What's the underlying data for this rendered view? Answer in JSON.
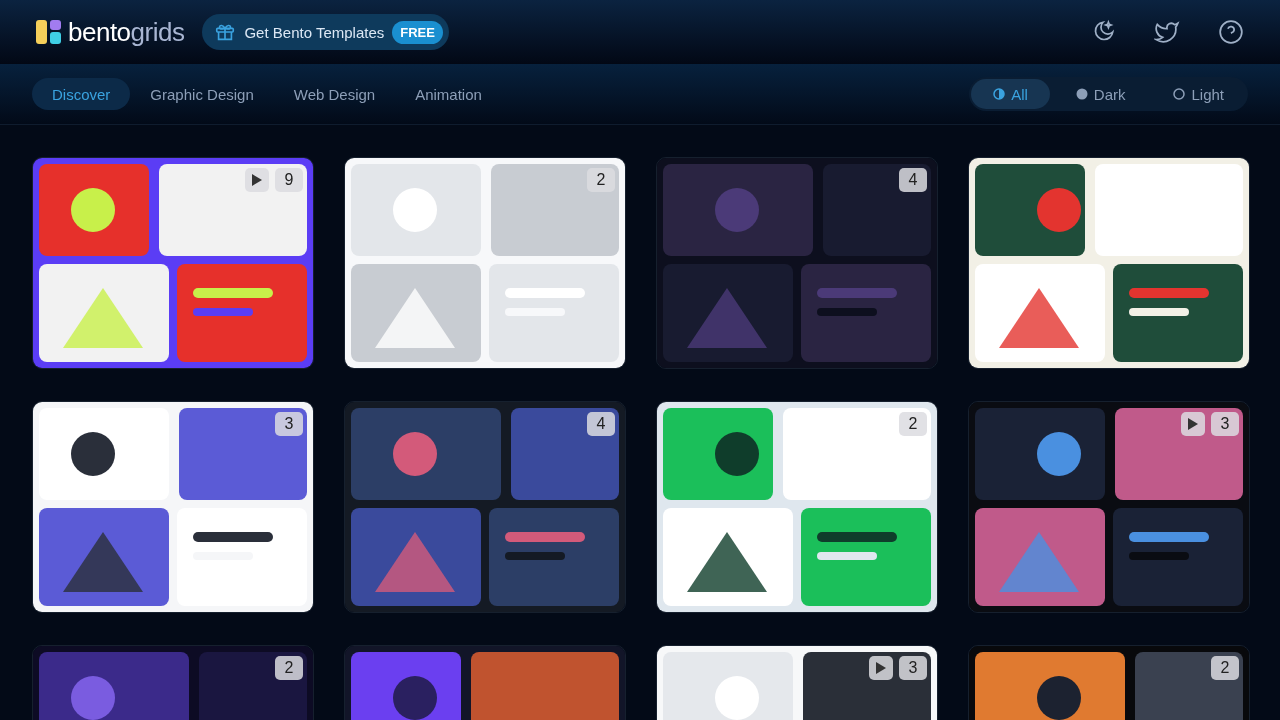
{
  "logo": {
    "first": "bento",
    "second": "grids"
  },
  "promo": {
    "label": "Get Bento Templates",
    "badge": "FREE"
  },
  "tabs": [
    {
      "label": "Discover",
      "selected": true
    },
    {
      "label": "Graphic Design",
      "selected": false
    },
    {
      "label": "Web Design",
      "selected": false
    },
    {
      "label": "Animation",
      "selected": false
    }
  ],
  "theme_filter": [
    {
      "label": "All",
      "kind": "all",
      "selected": true
    },
    {
      "label": "Dark",
      "kind": "dark",
      "selected": false
    },
    {
      "label": "Light",
      "kind": "light",
      "selected": false
    }
  ],
  "cards": [
    {
      "count": "9",
      "video": true
    },
    {
      "count": "2",
      "video": false
    },
    {
      "count": "4",
      "video": false
    },
    {
      "video": false
    },
    {
      "count": "3",
      "video": false
    },
    {
      "count": "4",
      "video": false
    },
    {
      "count": "2",
      "video": false
    },
    {
      "count": "3",
      "video": true
    },
    {
      "count": "2",
      "video": false
    },
    {
      "video": false
    },
    {
      "count": "3",
      "video": true
    },
    {
      "count": "2",
      "video": false
    }
  ]
}
